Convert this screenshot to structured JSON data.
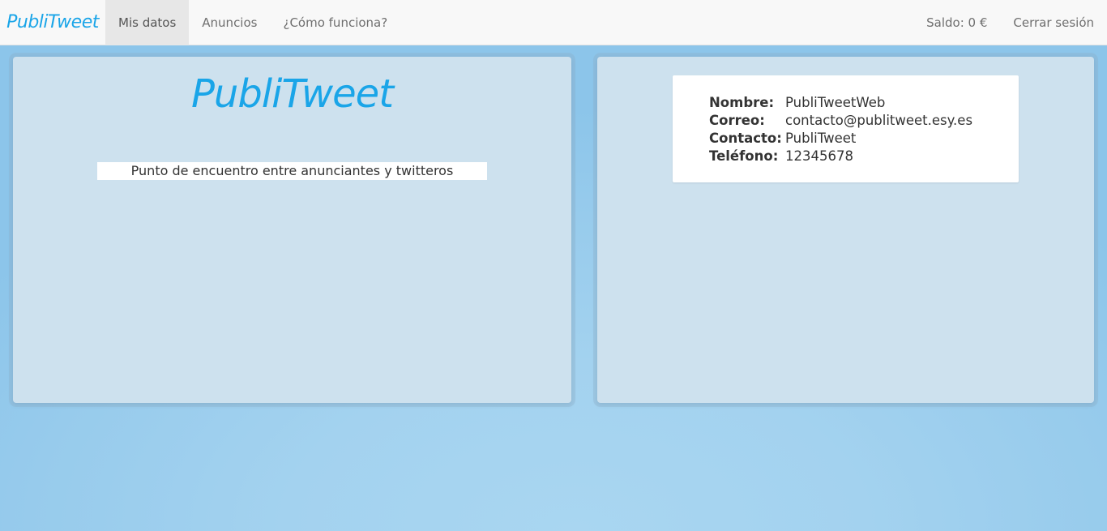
{
  "navbar": {
    "brand": "PubliTweet",
    "items": [
      {
        "label": "Mis datos",
        "active": true
      },
      {
        "label": "Anuncios",
        "active": false
      },
      {
        "label": "¿Cómo funciona?",
        "active": false
      }
    ],
    "balance": "Saldo: 0 €",
    "logout": "Cerrar sesión"
  },
  "left_panel": {
    "logo": "PubliTweet",
    "tagline": "Punto de encuentro entre anunciantes y twitteros"
  },
  "right_panel": {
    "fields": [
      {
        "label": "Nombre:",
        "value": "PubliTweetWeb"
      },
      {
        "label": "Correo:",
        "value": "contacto@publitweet.esy.es"
      },
      {
        "label": "Contacto:",
        "value": "PubliTweet"
      },
      {
        "label": "Teléfono:",
        "value": "12345678"
      }
    ]
  },
  "colors": {
    "brand": "#1aa5e8",
    "panel": "#cde1ee",
    "background": "#a3d2ef"
  }
}
